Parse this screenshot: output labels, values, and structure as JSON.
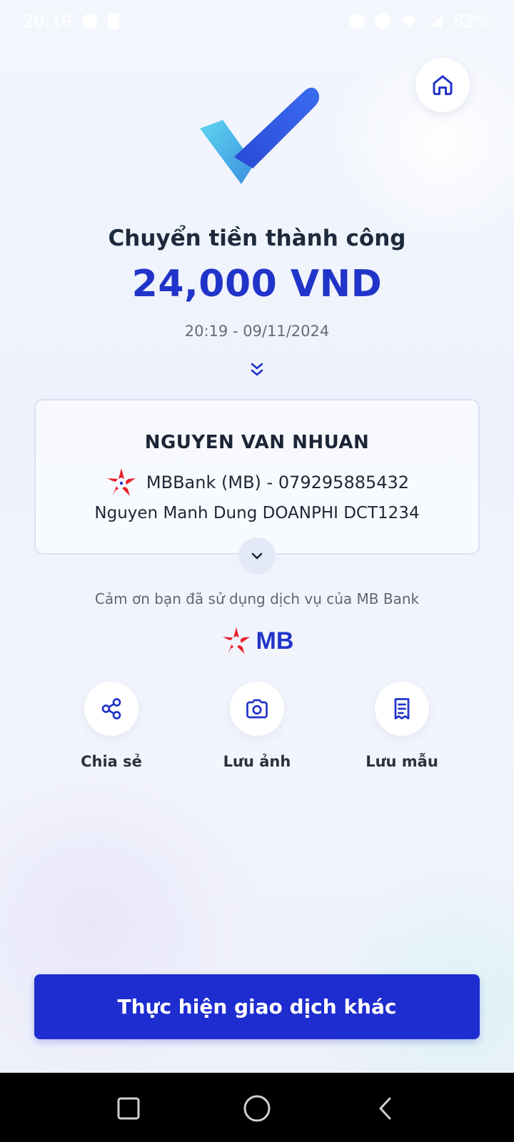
{
  "status_bar": {
    "time": "20:19",
    "battery": "82%"
  },
  "header": {
    "home_icon": "home-icon"
  },
  "result": {
    "title": "Chuyển tiền thành công",
    "amount": "24,000 VND",
    "datetime": "20:19 - 09/11/2024"
  },
  "recipient": {
    "name": "NGUYEN VAN NHUAN",
    "bank_account": "MBBank (MB) - 079295885432",
    "note": "Nguyen Manh Dung DOANPHI DCT1234"
  },
  "footer": {
    "thanks": "Cảm ơn bạn đã sử dụng dịch vụ của MB Bank",
    "logo_text": "MB"
  },
  "actions": [
    {
      "label": "Chia sẻ",
      "icon": "share-icon"
    },
    {
      "label": "Lưu ảnh",
      "icon": "camera-icon"
    },
    {
      "label": "Lưu mẫu",
      "icon": "receipt-icon"
    }
  ],
  "primary_button": {
    "label": "Thực hiện giao dịch khác"
  },
  "colors": {
    "brand_blue": "#1d2dd0",
    "amount_blue": "#2134c9",
    "brand_red": "#e8202b",
    "check_blue": "#2f5be0",
    "check_cyan": "#4cc4e8"
  }
}
